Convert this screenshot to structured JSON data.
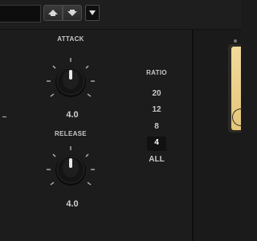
{
  "colors": {
    "background": "#1b1b1c",
    "label": "#c8c8c8",
    "knob_body": "#0e0e0e",
    "meter_face": "#e6c779"
  },
  "toolbar": {
    "preset_name": "",
    "preset_prev_icon": "arrow-up-icon",
    "preset_next_icon": "arrow-down-icon",
    "menu_icon": "triangle-down-icon"
  },
  "attack": {
    "label": "ATTACK",
    "value": "4.0"
  },
  "release": {
    "label": "RELEASE",
    "value": "4.0"
  },
  "ratio": {
    "label": "RATIO",
    "options": [
      "20",
      "12",
      "8",
      "4",
      "ALL"
    ],
    "selected": "4"
  }
}
